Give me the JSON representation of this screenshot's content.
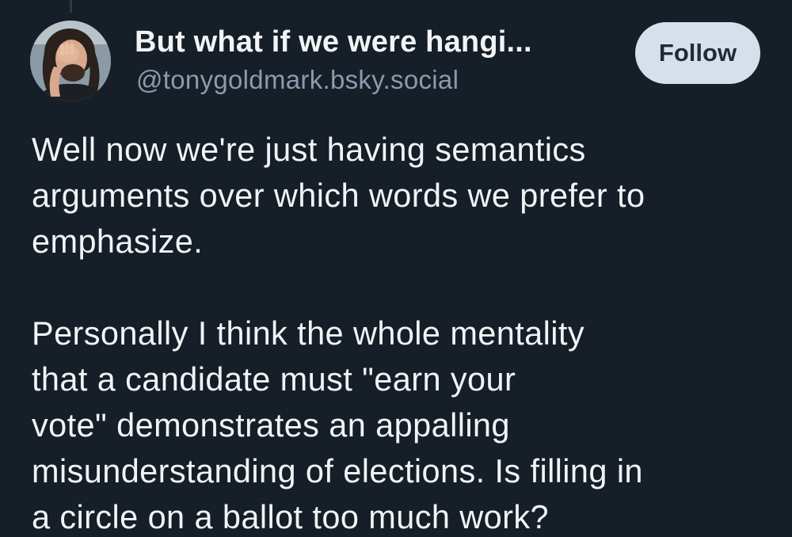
{
  "author": {
    "display_name": "But what if we were hangi...",
    "handle": "@tonygoldmark.bsky.social"
  },
  "follow_label": "Follow",
  "post": {
    "paragraphs": [
      {
        "lines": [
          "Well now we're just having semantics",
          "arguments over which words we prefer to",
          "emphasize."
        ]
      },
      {
        "lines": [
          "Personally I think the whole mentality",
          "that a candidate must \"earn your",
          "vote\" demonstrates an appalling",
          "misunderstanding of elections. Is filling in",
          "a circle on a ballot too much work?"
        ]
      }
    ]
  },
  "colors": {
    "background": "#161e27",
    "text": "#f1f3f5",
    "handle": "#8c9aab",
    "follow_button_bg": "#d7e0ea",
    "follow_button_text": "#1f2b39"
  }
}
